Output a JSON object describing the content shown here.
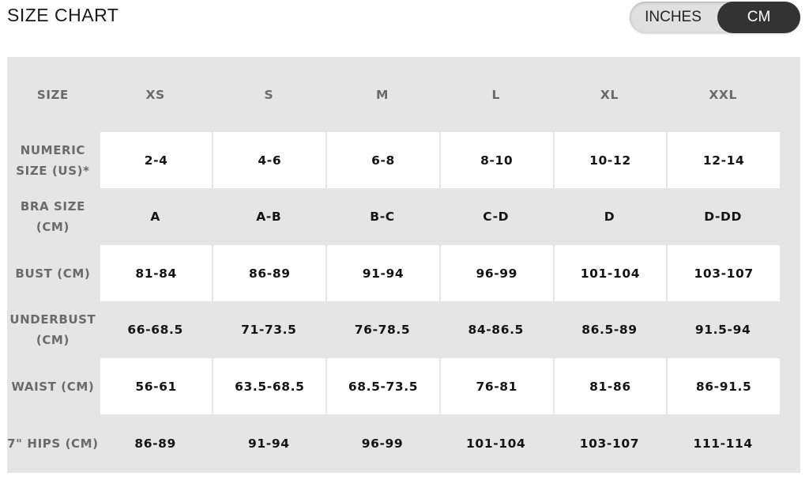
{
  "header": {
    "title": "SIZE CHART",
    "unit_toggle": {
      "options": [
        "INCHES",
        "CM"
      ],
      "selected": "CM"
    }
  },
  "colors": {
    "table_background": "#e5e5e5",
    "highlight_row": "#ffffff",
    "toggle_active": "#333333",
    "toggle_inactive": "#e0e0e0",
    "label_text": "#6a6a6a",
    "value_text": "#141414"
  },
  "table": {
    "header_label": "SIZE",
    "sizes": [
      "XS",
      "S",
      "M",
      "L",
      "XL",
      "XXL"
    ],
    "rows": [
      {
        "label": "NUMERIC SIZE (US)*",
        "values": [
          "2-4",
          "4-6",
          "6-8",
          "8-10",
          "10-12",
          "12-14"
        ]
      },
      {
        "label": "BRA SIZE (CM)",
        "values": [
          "A",
          "A-B",
          "B-C",
          "C-D",
          "D",
          "D-DD"
        ]
      },
      {
        "label": "BUST (CM)",
        "values": [
          "81-84",
          "86-89",
          "91-94",
          "96-99",
          "101-104",
          "103-107"
        ]
      },
      {
        "label": "UNDERBUST (CM)",
        "values": [
          "66-68.5",
          "71-73.5",
          "76-78.5",
          "84-86.5",
          "86.5-89",
          "91.5-94"
        ]
      },
      {
        "label": "WAIST (CM)",
        "values": [
          "56-61",
          "63.5-68.5",
          "68.5-73.5",
          "76-81",
          "81-86",
          "86-91.5"
        ]
      },
      {
        "label": "7\" HIPS (CM)",
        "values": [
          "86-89",
          "91-94",
          "96-99",
          "101-104",
          "103-107",
          "111-114"
        ]
      }
    ]
  }
}
